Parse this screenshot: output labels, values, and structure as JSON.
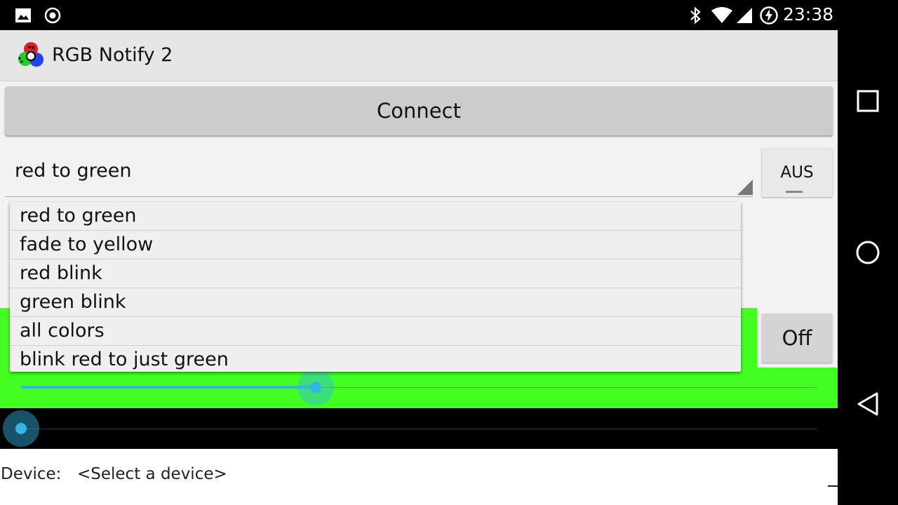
{
  "status_bar": {
    "time": "23:38",
    "icons_left": [
      "image-icon",
      "record-icon"
    ],
    "icons_right": [
      "bluetooth-icon",
      "wifi-icon",
      "signal-icon",
      "battery-charging-icon"
    ]
  },
  "app": {
    "title": "RGB Notify 2",
    "logo": "rgb-logo-icon"
  },
  "controls": {
    "connect_label": "Connect",
    "effect_selected": "red to green",
    "aus_label": "AUS",
    "off_label": "Off"
  },
  "dropdown": {
    "options": [
      "red to green",
      "fade to yellow",
      "red blink",
      "green blink",
      "all colors",
      "blink red to just green"
    ]
  },
  "sliders": {
    "green_slider_value": 0.37,
    "black_slider_value": 0.0
  },
  "device": {
    "label": "Device:",
    "value": "<Select a device>"
  },
  "colors": {
    "accent": "#33b5e5",
    "panel_green": "#44ff22",
    "actionbar": "#e6e6e6"
  },
  "nav_bar": [
    "recents-square-icon",
    "home-circle-icon",
    "back-triangle-icon"
  ]
}
